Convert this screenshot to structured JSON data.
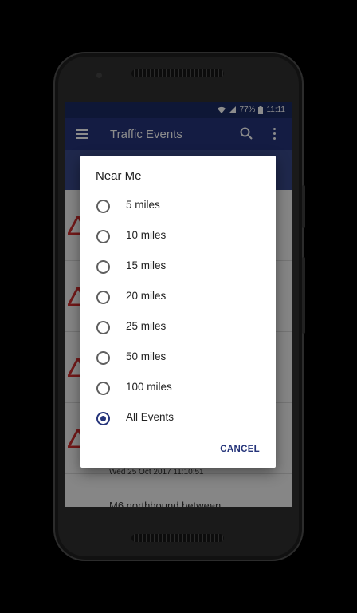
{
  "status_bar": {
    "battery": "77%",
    "time": "11:11"
  },
  "app_bar": {
    "title": "Traffic Events",
    "menu_icon": "hamburger-menu-icon",
    "search_icon": "search-icon",
    "more_icon": "more-vert-icon"
  },
  "background_list": {
    "timestamp": "Wed 25 Oct 2017 11:10:51",
    "last_title": "M6 northbound between"
  },
  "dialog": {
    "title": "Near Me",
    "options": [
      {
        "label": "5 miles",
        "selected": false
      },
      {
        "label": "10 miles",
        "selected": false
      },
      {
        "label": "15 miles",
        "selected": false
      },
      {
        "label": "20 miles",
        "selected": false
      },
      {
        "label": "25 miles",
        "selected": false
      },
      {
        "label": "50 miles",
        "selected": false
      },
      {
        "label": "100 miles",
        "selected": false
      },
      {
        "label": "All Events",
        "selected": true
      }
    ],
    "cancel_label": "CANCEL"
  },
  "colors": {
    "primary": "#25347a",
    "status_bar": "#1b2a63",
    "warning": "#d32f2f"
  }
}
